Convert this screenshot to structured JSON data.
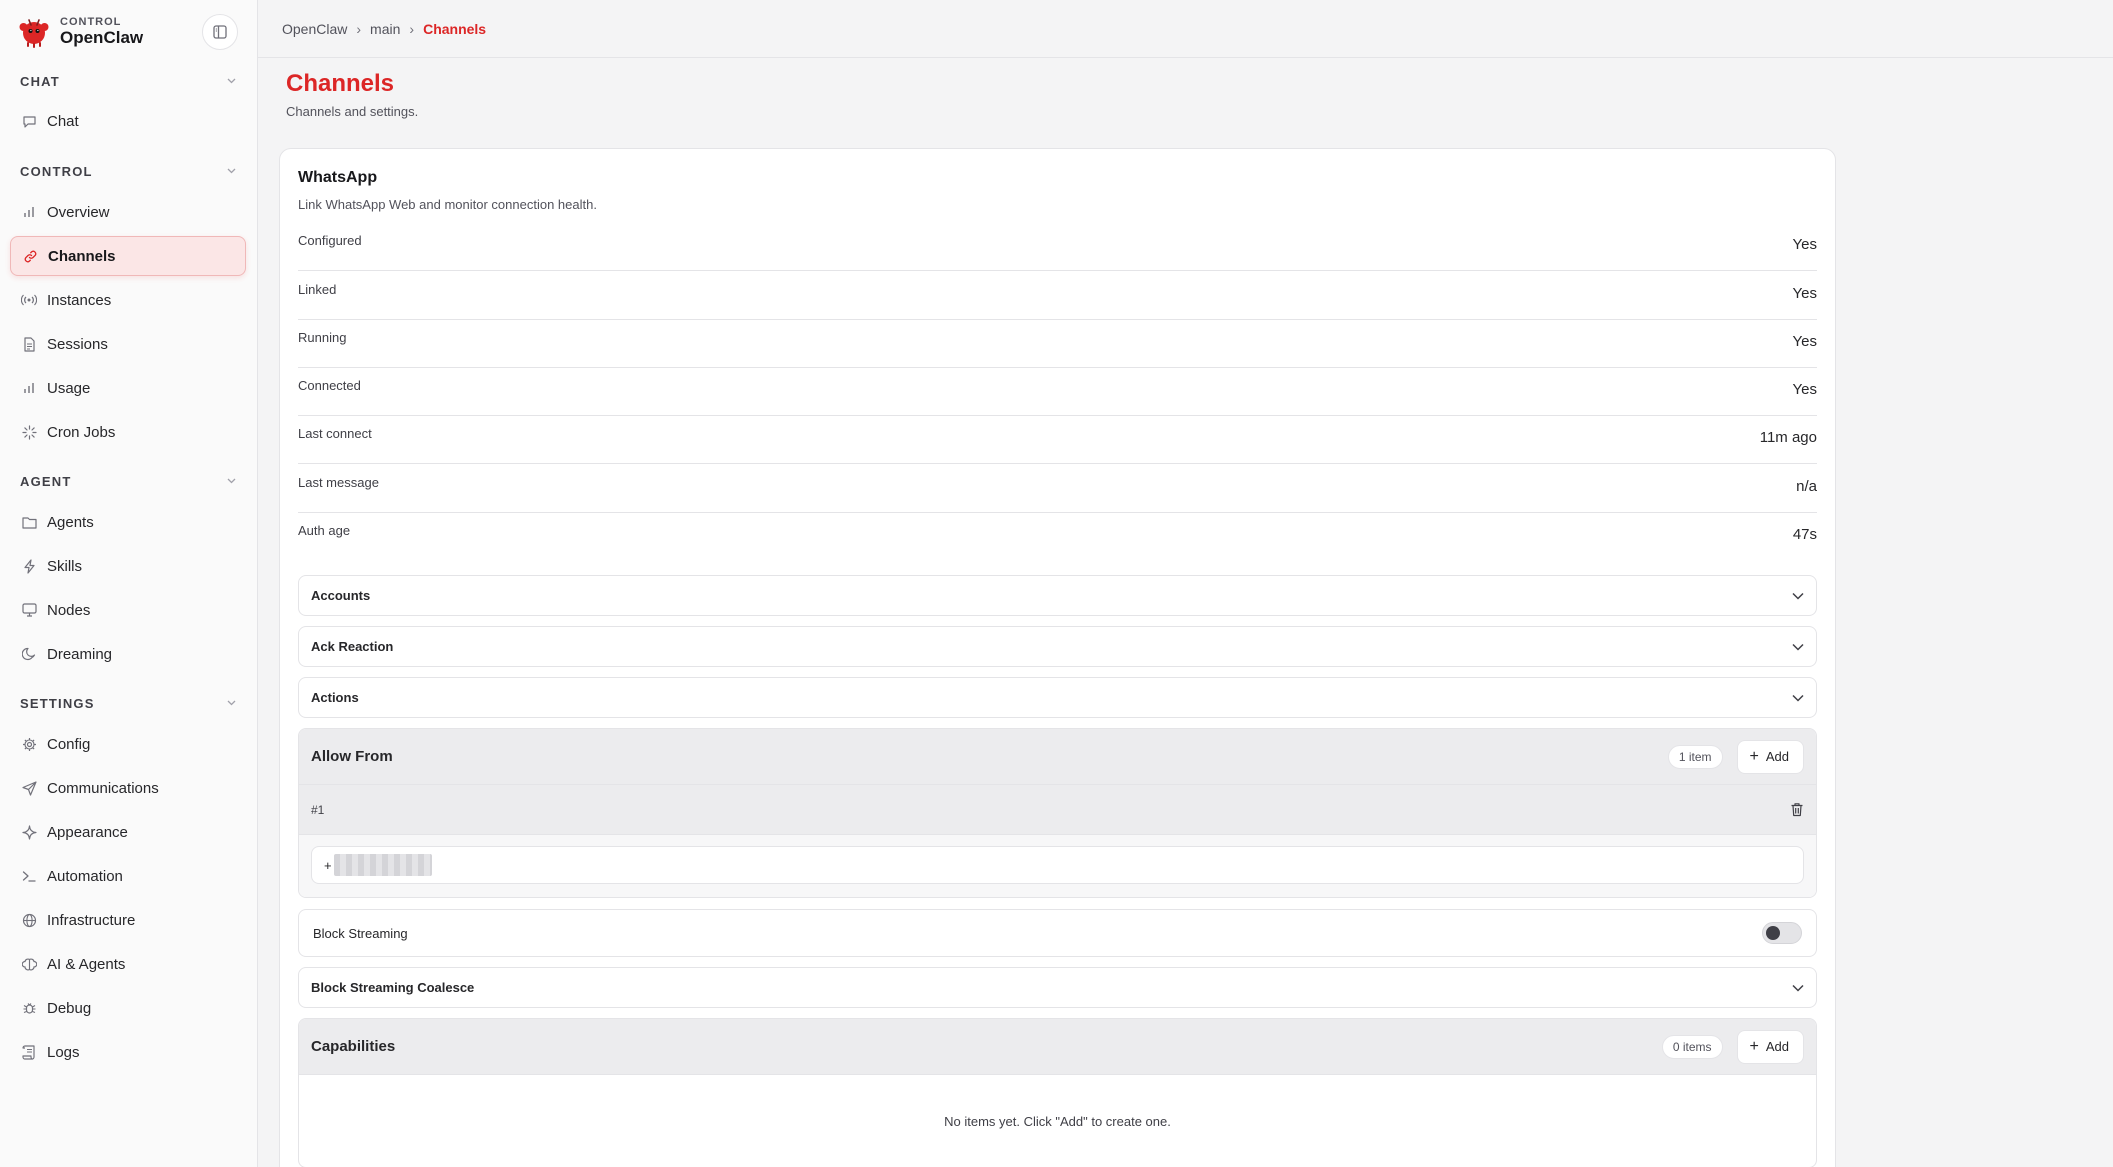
{
  "brand": {
    "eyebrow": "CONTROL",
    "name": "OpenClaw"
  },
  "sidebar": {
    "sections": [
      {
        "title": "CHAT",
        "items": [
          {
            "label": "Chat",
            "icon": "chat-icon"
          }
        ]
      },
      {
        "title": "CONTROL",
        "items": [
          {
            "label": "Overview",
            "icon": "bar-chart-icon"
          },
          {
            "label": "Channels",
            "icon": "link-icon",
            "active": true
          },
          {
            "label": "Instances",
            "icon": "radio-icon"
          },
          {
            "label": "Sessions",
            "icon": "document-icon"
          },
          {
            "label": "Usage",
            "icon": "bar-chart-icon"
          },
          {
            "label": "Cron Jobs",
            "icon": "loader-icon"
          }
        ]
      },
      {
        "title": "AGENT",
        "items": [
          {
            "label": "Agents",
            "icon": "folder-icon"
          },
          {
            "label": "Skills",
            "icon": "bolt-icon"
          },
          {
            "label": "Nodes",
            "icon": "monitor-icon"
          },
          {
            "label": "Dreaming",
            "icon": "moon-icon"
          }
        ]
      },
      {
        "title": "SETTINGS",
        "items": [
          {
            "label": "Config",
            "icon": "gear-icon"
          },
          {
            "label": "Communications",
            "icon": "send-icon"
          },
          {
            "label": "Appearance",
            "icon": "sparkle-icon"
          },
          {
            "label": "Automation",
            "icon": "terminal-icon"
          },
          {
            "label": "Infrastructure",
            "icon": "globe-icon"
          },
          {
            "label": "AI & Agents",
            "icon": "brain-icon"
          },
          {
            "label": "Debug",
            "icon": "bug-icon"
          },
          {
            "label": "Logs",
            "icon": "scroll-icon"
          }
        ]
      }
    ]
  },
  "breadcrumb": {
    "items": [
      "OpenClaw",
      "main"
    ],
    "current": "Channels"
  },
  "page": {
    "title": "Channels",
    "subtitle": "Channels and settings."
  },
  "whatsapp": {
    "title": "WhatsApp",
    "subtitle": "Link WhatsApp Web and monitor connection health.",
    "stats": [
      {
        "label": "Configured",
        "value": "Yes"
      },
      {
        "label": "Linked",
        "value": "Yes"
      },
      {
        "label": "Running",
        "value": "Yes"
      },
      {
        "label": "Connected",
        "value": "Yes"
      },
      {
        "label": "Last connect",
        "value": "11m ago"
      },
      {
        "label": "Last message",
        "value": "n/a"
      },
      {
        "label": "Auth age",
        "value": "47s"
      }
    ],
    "sections": {
      "accounts": "Accounts",
      "ack_reaction": "Ack Reaction",
      "actions": "Actions",
      "block_streaming_coalesce": "Block Streaming Coalesce"
    },
    "allow_from": {
      "title": "Allow From",
      "count": "1 item",
      "add_label": "Add",
      "items": [
        {
          "index": "#1",
          "value_prefix": "+"
        }
      ]
    },
    "block_streaming": {
      "label": "Block Streaming",
      "enabled": false
    },
    "capabilities": {
      "title": "Capabilities",
      "count": "0 items",
      "add_label": "Add",
      "empty": "No items yet. Click \"Add\" to create one."
    }
  },
  "colors": {
    "accent": "#dc2626",
    "active_bg": "#fbe6e6"
  }
}
